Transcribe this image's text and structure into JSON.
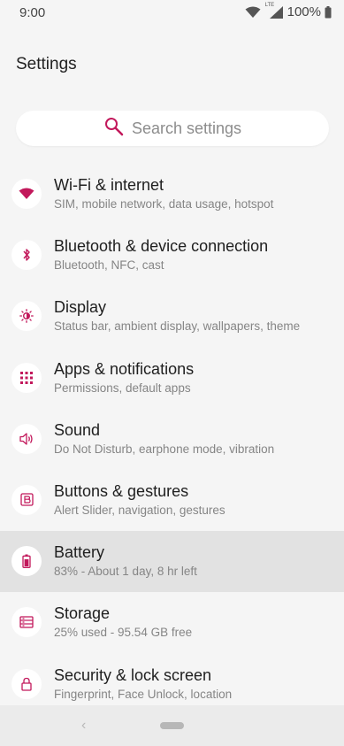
{
  "status": {
    "time": "9:00",
    "network_label": "LTE",
    "battery": "100%"
  },
  "page": {
    "title": "Settings"
  },
  "search": {
    "placeholder": "Search settings"
  },
  "items": [
    {
      "title": "Wi-Fi & internet",
      "subtitle": "SIM, mobile network, data usage, hotspot",
      "icon": "wifi-icon"
    },
    {
      "title": "Bluetooth & device connection",
      "subtitle": "Bluetooth, NFC, cast",
      "icon": "bluetooth-icon"
    },
    {
      "title": "Display",
      "subtitle": "Status bar, ambient display, wallpapers, theme",
      "icon": "brightness-icon"
    },
    {
      "title": "Apps & notifications",
      "subtitle": "Permissions, default apps",
      "icon": "apps-grid-icon"
    },
    {
      "title": "Sound",
      "subtitle": "Do Not Disturb, earphone mode, vibration",
      "icon": "volume-icon"
    },
    {
      "title": "Buttons & gestures",
      "subtitle": "Alert Slider, navigation, gestures",
      "icon": "button-icon"
    },
    {
      "title": "Battery",
      "subtitle": "83% - About 1 day, 8 hr left",
      "icon": "battery-icon"
    },
    {
      "title": "Storage",
      "subtitle": "25% used - 95.54 GB free",
      "icon": "storage-icon"
    },
    {
      "title": "Security & lock screen",
      "subtitle": "Fingerprint, Face Unlock, location",
      "icon": "lock-icon"
    }
  ],
  "colors": {
    "accent": "#c2185b",
    "background": "#f5f5f5",
    "highlight": "#e2e2e2"
  }
}
